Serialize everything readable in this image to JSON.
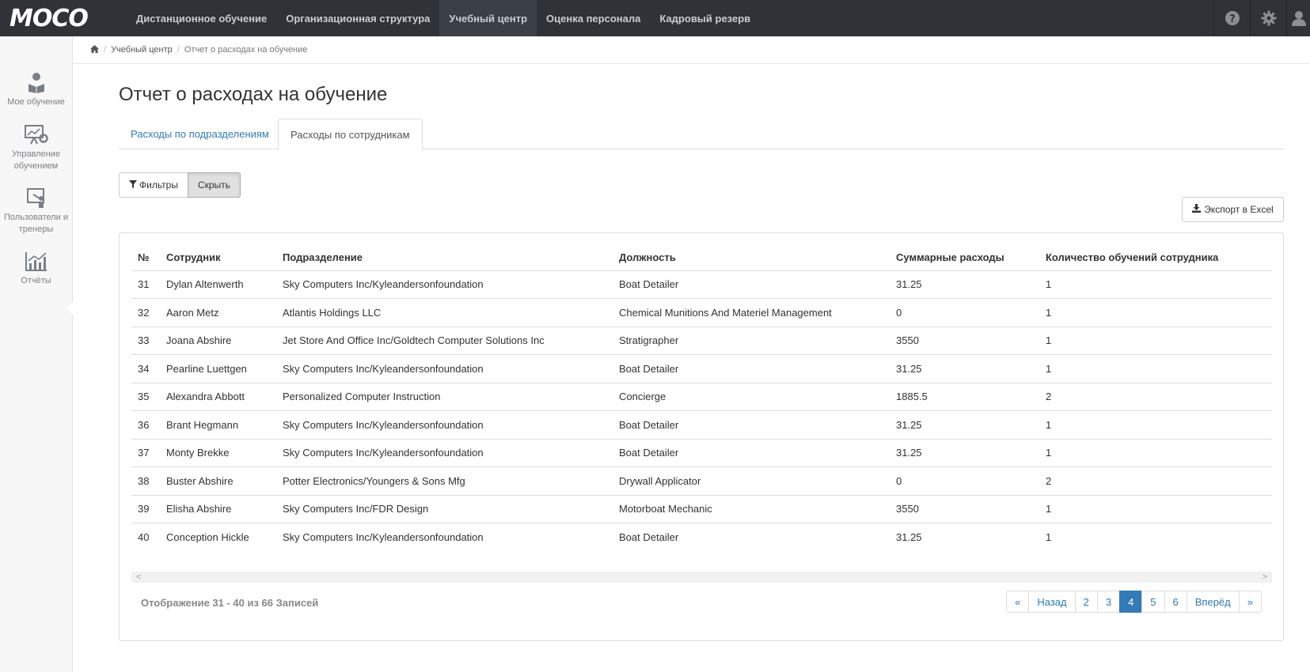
{
  "app": {
    "logo": "MOCO",
    "nav": [
      {
        "label": "Дистанционное обучение"
      },
      {
        "label": "Организационная структура"
      },
      {
        "label": "Учебный центр"
      },
      {
        "label": "Оценка персонала"
      },
      {
        "label": "Кадровый резерв"
      }
    ],
    "active_nav": "Учебный центр",
    "right_icons": [
      "help-icon",
      "gear-icon",
      "user-icon"
    ]
  },
  "sidebar": {
    "items": [
      {
        "label": "Мое обучение",
        "icon": "reader-icon"
      },
      {
        "label": "Управление обучением",
        "icon": "presentation-gear-icon"
      },
      {
        "label": "Пользователи и тренеры",
        "icon": "trainer-board-icon"
      },
      {
        "label": "Отчёты",
        "icon": "chart-icon"
      }
    ],
    "active": "Отчёты"
  },
  "breadcrumb": {
    "home_icon": "home-icon",
    "items": [
      "Учебный центр",
      "Отчет о расходах на обучение"
    ]
  },
  "page": {
    "title": "Отчет о расходах на обучение",
    "tabs": [
      {
        "label": "Расходы по подразделениям"
      },
      {
        "label": "Расходы по сотрудникам"
      }
    ],
    "active_tab": "Расходы по сотрудникам",
    "filters_label": "Фильтры",
    "hide_label": "Скрыть",
    "export_label": "Экспорт в Excel"
  },
  "table": {
    "columns": [
      "№",
      "Сотрудник",
      "Подразделение",
      "Должность",
      "Суммарные расходы",
      "Количество обучений сотрудника"
    ],
    "rows": [
      [
        "31",
        "Dylan Altenwerth",
        "Sky Computers Inc/Kyleandersonfoundation",
        "Boat Detailer",
        "31.25",
        "1"
      ],
      [
        "32",
        "Aaron Metz",
        "Atlantis Holdings LLC",
        "Chemical Munitions And Materiel Management",
        "0",
        "1"
      ],
      [
        "33",
        "Joana Abshire",
        "Jet Store And Office Inc/Goldtech Computer Solutions Inc",
        "Stratigrapher",
        "3550",
        "1"
      ],
      [
        "34",
        "Pearline Luettgen",
        "Sky Computers Inc/Kyleandersonfoundation",
        "Boat Detailer",
        "31.25",
        "1"
      ],
      [
        "35",
        "Alexandra Abbott",
        "Personalized Computer Instruction",
        "Concierge",
        "1885.5",
        "2"
      ],
      [
        "36",
        "Brant Hegmann",
        "Sky Computers Inc/Kyleandersonfoundation",
        "Boat Detailer",
        "31.25",
        "1"
      ],
      [
        "37",
        "Monty Brekke",
        "Sky Computers Inc/Kyleandersonfoundation",
        "Boat Detailer",
        "31.25",
        "1"
      ],
      [
        "38",
        "Buster Abshire",
        "Potter Electronics/Youngers & Sons Mfg",
        "Drywall Applicator",
        "0",
        "2"
      ],
      [
        "39",
        "Elisha Abshire",
        "Sky Computers Inc/FDR Design",
        "Motorboat Mechanic",
        "3550",
        "1"
      ],
      [
        "40",
        "Conception Hickle",
        "Sky Computers Inc/Kyleandersonfoundation",
        "Boat Detailer",
        "31.25",
        "1"
      ]
    ]
  },
  "footer": {
    "info": "Отображение 31 - 40 из 66 Записей",
    "pagination": [
      "«",
      "Назад",
      "2",
      "3",
      "4",
      "5",
      "6",
      "Вперёд",
      "»"
    ],
    "current_page": "4"
  },
  "colors": {
    "topbar": "#2f3338",
    "link": "#337ab7",
    "active_page": "#337ab7"
  }
}
